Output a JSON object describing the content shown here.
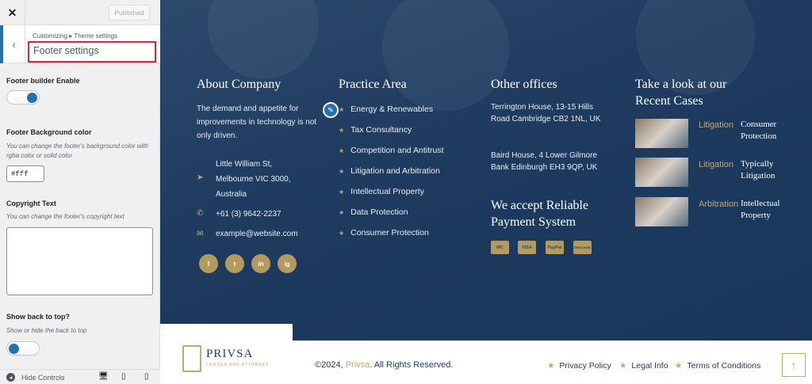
{
  "customizer": {
    "published_label": "Published",
    "breadcrumb_1": "Customizing",
    "breadcrumb_sep": "▸",
    "breadcrumb_2": "Theme settings",
    "section_title": "Footer settings",
    "footer_builder": {
      "label": "Footer builder Enable",
      "toggle_text": "NO"
    },
    "bg_color": {
      "label": "Footer Background color",
      "description": "You can change the footer's background color with rgba color or solid color",
      "value": "#fff"
    },
    "copyright": {
      "label": "Copyright Text",
      "description": "You can change the footer's copyright text",
      "value": ""
    },
    "back_to_top": {
      "label": "Show back to top?",
      "description": "Show or hide the back to top",
      "toggle_text": "YES"
    },
    "hide_controls": "Hide Controls"
  },
  "footer": {
    "about": {
      "title": "About Company",
      "text": "The demand and appetite for improvements in technology is not only driven.",
      "address": "Little William St, Melbourne VIC 3000, Australia",
      "phone": "+61 (3) 9642-2237",
      "email": "example@website.com",
      "social": [
        "f",
        "t",
        "in",
        "ig"
      ]
    },
    "practice": {
      "title": "Practice Area",
      "items": [
        "Energy & Renewables",
        "Tax Consultancy",
        "Competition and Antitrust",
        "Litigation and Arbitration",
        "Intellectual Property",
        "Data Protection",
        "Consumer Protection"
      ]
    },
    "offices": {
      "title": "Other offices",
      "office_1": "Terrington House, 13-15 Hills Road Cambridge CB2 1NL, UK",
      "office_2": "Baird House, 4 Lower Gilmore Bank Edinburgh EH3 9QP, UK",
      "payment_title": "We accept Reliable Payment System",
      "payments": [
        "MC",
        "VISA",
        "PayPal",
        "DISCOVER"
      ]
    },
    "cases": {
      "title": "Take a look at our Recent Cases",
      "items": [
        {
          "category": "Litigation",
          "title": "Consumer Protection"
        },
        {
          "category": "Litigation",
          "title": "Typically Litigation"
        },
        {
          "category": "Arbitration",
          "title": "Intellectual Property"
        }
      ]
    },
    "logo": {
      "name": "PRIVSA",
      "tagline": "LAWYER AND ATTORNEY"
    },
    "copyright_prefix": "©2024, ",
    "copyright_brand": "Privsa",
    "copyright_suffix": ". All Rights Reserved.",
    "links": [
      "Privacy Policy",
      "Legal Info",
      "Terms of Conditions"
    ]
  }
}
